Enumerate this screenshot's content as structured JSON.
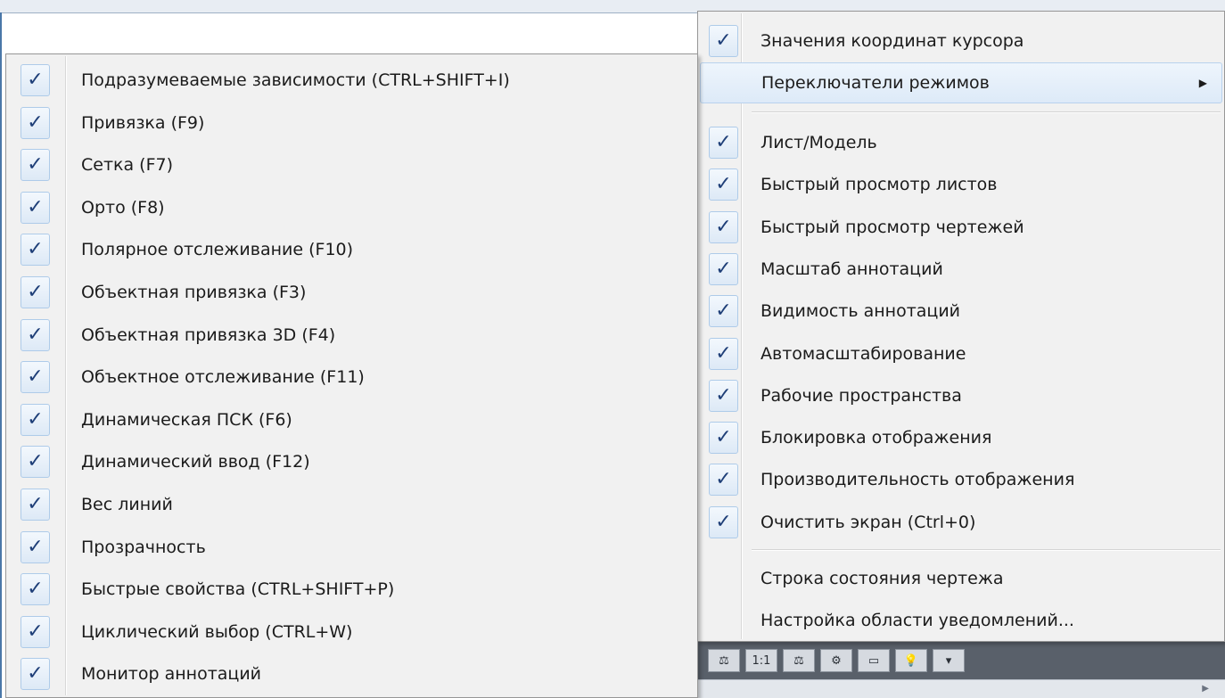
{
  "right_menu": {
    "top_items": [
      {
        "label": "Значения координат курсора",
        "checked": true
      },
      {
        "label": "Переключатели режимов",
        "checked": false,
        "submenu": true
      }
    ],
    "middle_items": [
      {
        "label": "Лист/Модель",
        "checked": true
      },
      {
        "label": "Быстрый просмотр листов",
        "checked": true
      },
      {
        "label": "Быстрый просмотр чертежей",
        "checked": true
      },
      {
        "label": "Масштаб аннотаций",
        "checked": true
      },
      {
        "label": "Видимость аннотаций",
        "checked": true
      },
      {
        "label": "Автомасштабирование",
        "checked": true
      },
      {
        "label": "Рабочие пространства",
        "checked": true
      },
      {
        "label": "Блокировка отображения",
        "checked": true
      },
      {
        "label": "Производительность отображения",
        "checked": true
      },
      {
        "label": "Очистить экран (Ctrl+0)",
        "checked": true
      }
    ],
    "bottom_items": [
      {
        "label": "Строка состояния чертежа",
        "checked": false
      },
      {
        "label": "Настройка области уведомлений...",
        "checked": false
      }
    ]
  },
  "left_submenu": {
    "items": [
      {
        "label": "Подразумеваемые зависимости (CTRL+SHIFT+I)",
        "checked": true
      },
      {
        "label": "Привязка (F9)",
        "checked": true
      },
      {
        "label": "Сетка (F7)",
        "checked": true
      },
      {
        "label": "Орто (F8)",
        "checked": true
      },
      {
        "label": "Полярное отслеживание (F10)",
        "checked": true
      },
      {
        "label": "Объектная привязка (F3)",
        "checked": true
      },
      {
        "label": "Объектная привязка 3D (F4)",
        "checked": true
      },
      {
        "label": "Объектное отслеживание (F11)",
        "checked": true
      },
      {
        "label": "Динамическая ПСК (F6)",
        "checked": true
      },
      {
        "label": "Динамический ввод (F12)",
        "checked": true
      },
      {
        "label": "Вес линий",
        "checked": true
      },
      {
        "label": "Прозрачность",
        "checked": true
      },
      {
        "label": "Быстрые свойства (CTRL+SHIFT+P)",
        "checked": true
      },
      {
        "label": "Циклический выбор (CTRL+W)",
        "checked": true
      },
      {
        "label": "Монитор аннотаций",
        "checked": true
      }
    ]
  },
  "toolbar": {
    "scale_label": "1:1"
  },
  "icons": {
    "check": "check-icon",
    "submenu": "chevron-right-icon"
  },
  "colors": {
    "menu_bg": "#f1f1f1",
    "check_color": "#1f3f78",
    "hover_bg": "#ddeaf8"
  }
}
